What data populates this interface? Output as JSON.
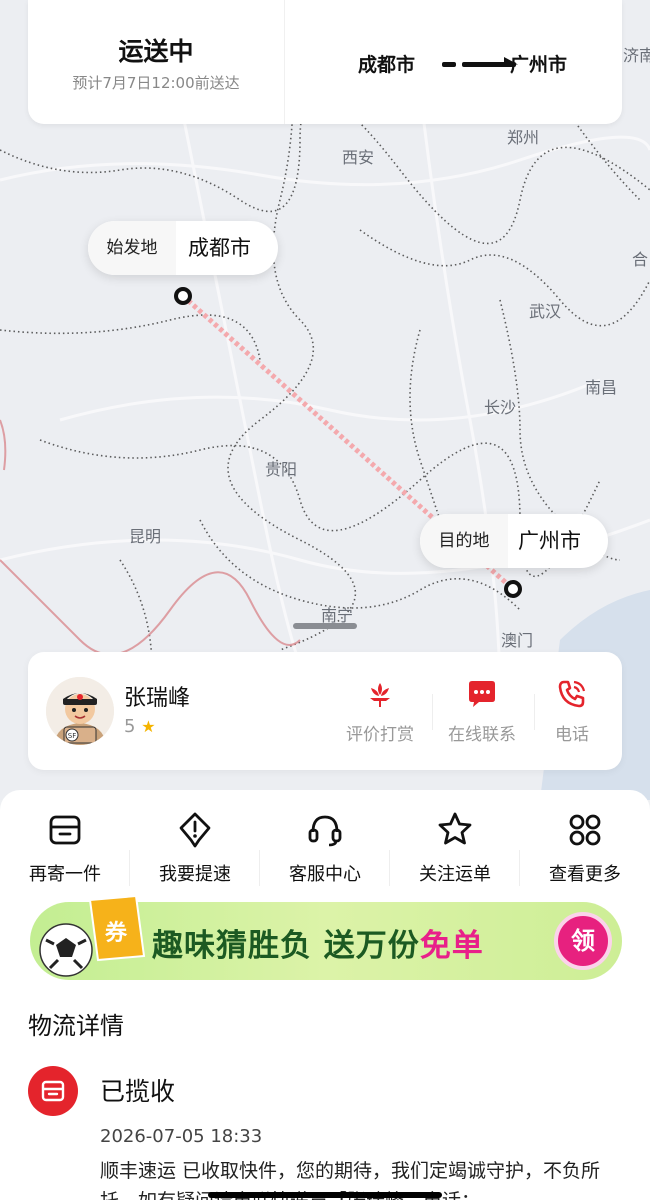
{
  "status": {
    "title": "运送中",
    "eta": "预计7月7日12:00前送达",
    "origin_city": "成都市",
    "dest_city": "广州市"
  },
  "map": {
    "origin_tag": "始发地",
    "origin_place": "成都市",
    "dest_tag": "目的地",
    "dest_place": "广州市",
    "cities": {
      "jinan": "济南",
      "zhengzhou": "郑州",
      "xian": "西安",
      "hefei": "合",
      "wuhan": "武汉",
      "nanchang": "南昌",
      "changsha": "长沙",
      "guiyang": "贵阳",
      "kunming": "昆明",
      "nanning": "南宁",
      "macau": "澳门"
    },
    "route_color": "#f4a9ad"
  },
  "courier": {
    "name": "张瑞峰",
    "rating": "5",
    "actions": {
      "tip": "评价打赏",
      "chat": "在线联系",
      "call": "电话"
    },
    "accent": "#e4242c"
  },
  "quick_actions": {
    "resend": "再寄一件",
    "expedite": "我要提速",
    "service": "客服中心",
    "follow": "关注运单",
    "more": "查看更多"
  },
  "banner": {
    "text_main": "趣味猜胜负 送万份",
    "text_hot": "免单",
    "claim": "领",
    "badge_char": "券"
  },
  "logistics": {
    "section_title": "物流详情",
    "event_title": "已揽收",
    "event_time": "2026-07-05 18:33",
    "event_desc": "顺丰速运 已收取快件，您的期待，我们定竭诚守护，不负所托。如有疑问请电联快递员【张瑞峰，电话："
  }
}
